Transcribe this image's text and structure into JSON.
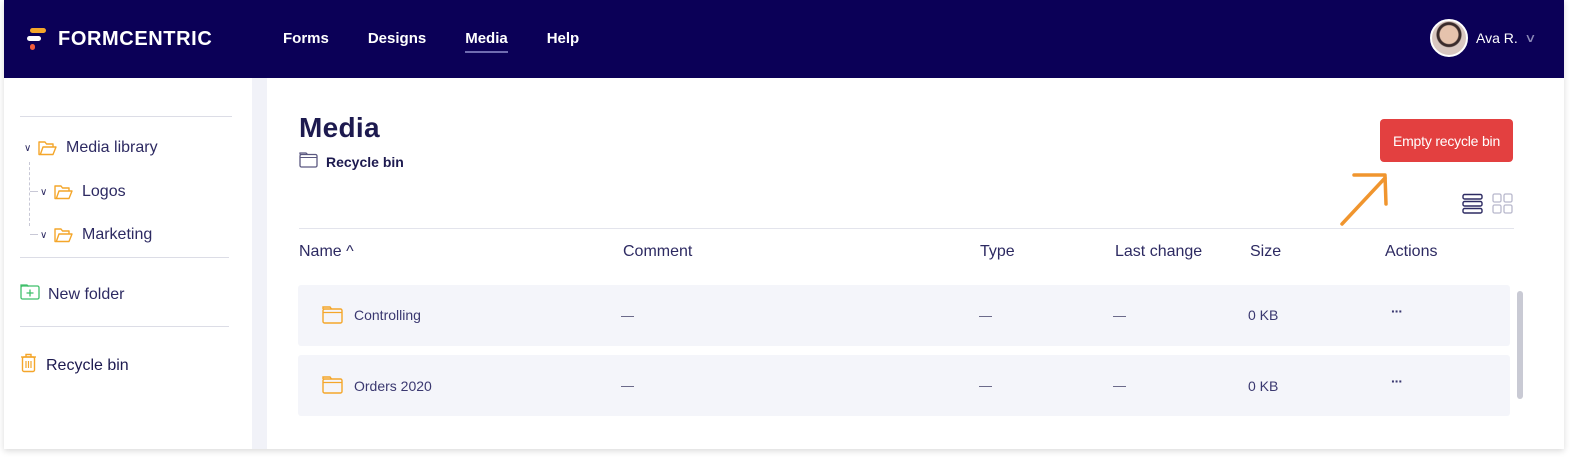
{
  "app": {
    "logo_text": "FORMCENTRIC"
  },
  "nav": {
    "items": [
      {
        "label": "Forms",
        "active": false
      },
      {
        "label": "Designs",
        "active": false
      },
      {
        "label": "Media",
        "active": true
      },
      {
        "label": "Help",
        "active": false
      }
    ]
  },
  "user": {
    "name": "Ava R."
  },
  "sidebar": {
    "tree": [
      {
        "label": "Media library"
      },
      {
        "label": "Logos"
      },
      {
        "label": "Marketing"
      }
    ],
    "new_folder": "New folder",
    "recycle_bin": "Recycle bin"
  },
  "main": {
    "title": "Media",
    "breadcrumb": "Recycle bin",
    "empty_button": "Empty recycle bin",
    "columns": [
      "Name ^",
      "Comment",
      "Type",
      "Last change",
      "Size",
      "Actions"
    ],
    "rows": [
      {
        "name": "Controlling",
        "size": "0 KB",
        "actions": "···"
      },
      {
        "name": "Orders 2020",
        "size": "0 KB",
        "actions": "···"
      }
    ]
  },
  "colors": {
    "topbar": "#0b0057",
    "accent_button": "#e34040",
    "folder_orange": "#f4a62a",
    "annotation_arrow": "#f0952e"
  }
}
